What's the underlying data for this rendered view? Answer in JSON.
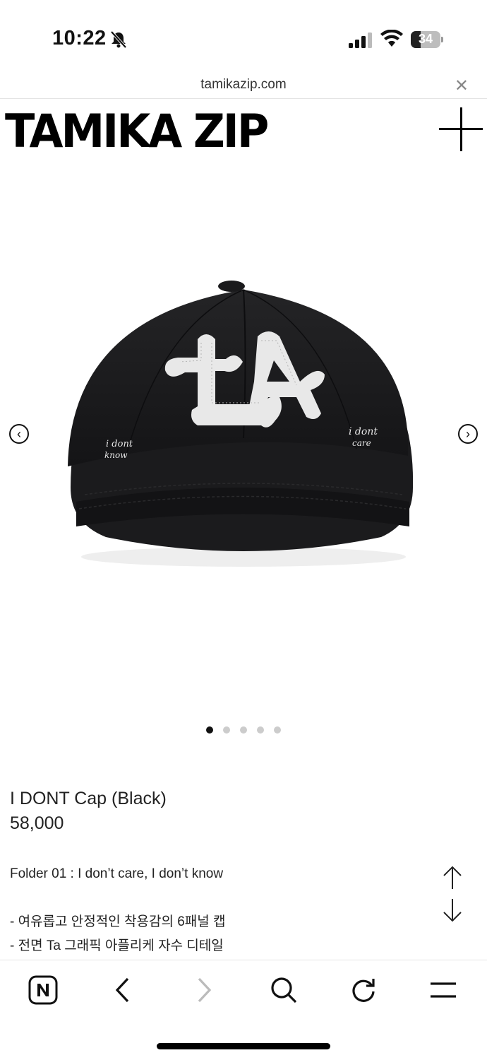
{
  "status_bar": {
    "time": "10:22",
    "battery": "34",
    "battery_level": 0.34,
    "icons": [
      "bell-slash-icon",
      "signal-icon",
      "wifi-icon",
      "battery-icon"
    ]
  },
  "browser": {
    "url": "tamikazip.com",
    "close_icon": "close-icon"
  },
  "header": {
    "logo": "TAMIKA ZIP",
    "menu_icon": "plus-icon"
  },
  "carousel": {
    "image_alt": "black cap with TA patch",
    "patch_left_line1": "i dont",
    "patch_left_line2": "know",
    "patch_right_line1": "i dont",
    "patch_right_line2": "care",
    "total_slides": 5,
    "active_slide": 1,
    "prev_icon": "chevron-left-circle-icon",
    "next_icon": "chevron-right-circle-icon"
  },
  "product": {
    "name": "I DONT Cap (Black)",
    "price": "58,000",
    "description": [
      "Folder 01 : I don’t care, I don’t know",
      "",
      "- 여유롭고 안정적인 착용감의 6패널 캡",
      "- 전면 Ta 그래픽 아플리케 자수 디테일"
    ]
  },
  "toolbar": {
    "icons": [
      "naver-home-icon",
      "back-icon",
      "forward-icon",
      "search-icon",
      "reload-icon",
      "menu-icon"
    ]
  },
  "colors": {
    "text": "#111111",
    "dot_inactive": "#cccccc",
    "cap": "#1a1a1c",
    "patch": "#e8e8e8"
  }
}
